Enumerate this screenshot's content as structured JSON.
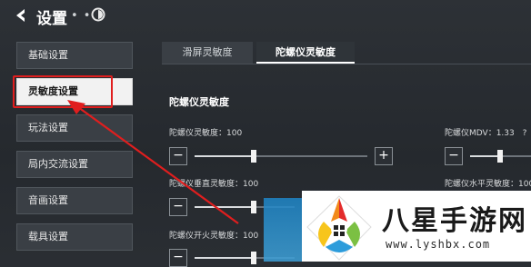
{
  "header": {
    "title": "设置",
    "dots": "• •"
  },
  "sidebar": {
    "items": [
      {
        "label": "基础设置",
        "active": false
      },
      {
        "label": "灵敏度设置",
        "active": true
      },
      {
        "label": "玩法设置",
        "active": false
      },
      {
        "label": "局内交流设置",
        "active": false
      },
      {
        "label": "音画设置",
        "active": false
      },
      {
        "label": "载具设置",
        "active": false
      }
    ]
  },
  "tabs": [
    {
      "label": "滑屏灵敏度",
      "active": false
    },
    {
      "label": "陀螺仪灵敏度",
      "active": true
    }
  ],
  "section": {
    "title": "陀螺仪灵敏度"
  },
  "sliders": {
    "gyro": {
      "label": "陀螺仪灵敏度：100",
      "value": 100
    },
    "vertical": {
      "label": "陀螺仪垂直灵敏度：100",
      "value": 100
    },
    "fire": {
      "label": "陀螺仪开火灵敏度：100",
      "value": 100
    },
    "mdv": {
      "label": "陀螺仪MDV：1.33",
      "suffix": "?",
      "value": 1.33
    },
    "horizontal": {
      "label": "陀螺仪水平灵敏度：100",
      "value": 100
    }
  },
  "controls": {
    "minus": "−",
    "plus": "+"
  },
  "watermark": {
    "title": "八星手游网",
    "url": "www.lyshbx.com"
  },
  "colors": {
    "annotation": "#e01e1e",
    "active_tab_bg": "#2f3439",
    "active_sidebar_bg": "#f2f2f2"
  }
}
